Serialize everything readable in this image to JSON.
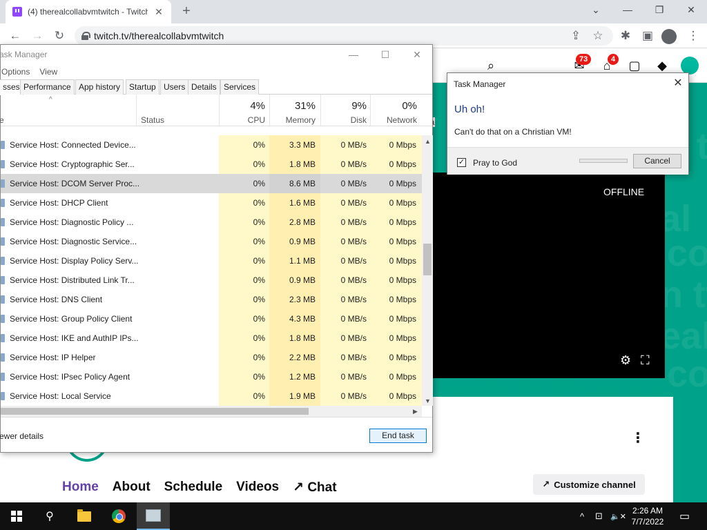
{
  "browser": {
    "tab_title": "(4) therealcollabvmtwitch - Twitch",
    "tab_close": "✕",
    "new_tab": "+",
    "url": "twitch.tv/therealcollabvmtwitch",
    "window_controls": [
      "⌄",
      "—",
      "❐",
      "✕"
    ],
    "nav": {
      "back": "←",
      "forward": "→",
      "reload": "↻"
    },
    "toolbar_icons": {
      "share": "⇪",
      "star": "☆",
      "extensions": "✱",
      "sidepanel": "▣",
      "menu": "⋮"
    }
  },
  "twitch": {
    "notifications_badge": "73",
    "inbox_badge": "4",
    "player_status": "OFFLINE",
    "background_text": [
      "itch thereal",
      "co",
      "n t",
      "eal",
      "co",
      "n tw",
      "eal",
      "co",
      "twitch thereal",
      "co",
      "n t",
      "eal"
    ],
    "channel_nav": [
      "Home",
      "About",
      "Schedule",
      "Videos",
      "Chat"
    ],
    "chat_arrow": "↗",
    "customize_label": "Customize channel",
    "customize_arrow": "↗",
    "kebab": "⋮",
    "icons": {
      "search": "⌕",
      "bell": "✉",
      "inbox": "⌂",
      "chat": "▢",
      "prime": "◆"
    },
    "player_icons": {
      "settings": "⚙",
      "fullscreen": "⛶"
    },
    "partial_text": "ial"
  },
  "task_manager": {
    "title": "Task Manager",
    "title_partial": "ask Manager",
    "window_controls": [
      "—",
      "☐",
      "✕"
    ],
    "menu": [
      "Options",
      "View"
    ],
    "tabs": [
      "sses",
      "Performance",
      "App history",
      "Startup",
      "Users",
      "Details",
      "Services"
    ],
    "header": {
      "name": "e",
      "status": "Status",
      "cpu_pct": "4%",
      "cpu": "CPU",
      "mem_pct": "31%",
      "mem": "Memory",
      "disk_pct": "9%",
      "disk": "Disk",
      "net_pct": "0%",
      "net": "Network",
      "sort_caret": "^"
    },
    "rows": [
      {
        "name": "Service Host: Connected Device...",
        "cpu": "0%",
        "memory": "3.3 MB",
        "disk": "0 MB/s",
        "network": "0 Mbps"
      },
      {
        "name": "Service Host: Cryptographic Ser...",
        "cpu": "0%",
        "memory": "1.8 MB",
        "disk": "0 MB/s",
        "network": "0 Mbps"
      },
      {
        "name": "Service Host: DCOM Server Proc...",
        "cpu": "0%",
        "memory": "8.6 MB",
        "disk": "0 MB/s",
        "network": "0 Mbps"
      },
      {
        "name": "Service Host: DHCP Client",
        "cpu": "0%",
        "memory": "1.6 MB",
        "disk": "0 MB/s",
        "network": "0 Mbps"
      },
      {
        "name": "Service Host: Diagnostic Policy ...",
        "cpu": "0%",
        "memory": "2.8 MB",
        "disk": "0 MB/s",
        "network": "0 Mbps"
      },
      {
        "name": "Service Host: Diagnostic Service...",
        "cpu": "0%",
        "memory": "0.9 MB",
        "disk": "0 MB/s",
        "network": "0 Mbps"
      },
      {
        "name": "Service Host: Display Policy Serv...",
        "cpu": "0%",
        "memory": "1.1 MB",
        "disk": "0 MB/s",
        "network": "0 Mbps"
      },
      {
        "name": "Service Host: Distributed Link Tr...",
        "cpu": "0%",
        "memory": "0.9 MB",
        "disk": "0 MB/s",
        "network": "0 Mbps"
      },
      {
        "name": "Service Host: DNS Client",
        "cpu": "0%",
        "memory": "2.3 MB",
        "disk": "0 MB/s",
        "network": "0 Mbps"
      },
      {
        "name": "Service Host: Group Policy Client",
        "cpu": "0%",
        "memory": "4.3 MB",
        "disk": "0 MB/s",
        "network": "0 Mbps"
      },
      {
        "name": "Service Host: IKE and AuthIP IPs...",
        "cpu": "0%",
        "memory": "1.8 MB",
        "disk": "0 MB/s",
        "network": "0 Mbps"
      },
      {
        "name": "Service Host: IP Helper",
        "cpu": "0%",
        "memory": "2.2 MB",
        "disk": "0 MB/s",
        "network": "0 Mbps"
      },
      {
        "name": "Service Host: IPsec Policy Agent",
        "cpu": "0%",
        "memory": "1.2 MB",
        "disk": "0 MB/s",
        "network": "0 Mbps"
      },
      {
        "name": "Service Host: Local Service",
        "cpu": "0%",
        "memory": "1.9 MB",
        "disk": "0 MB/s",
        "network": "0 Mbps"
      }
    ],
    "selected_row": 2,
    "fewer_details": "ewer details",
    "end_task": "End task",
    "scroll_arrows": {
      "up": "▲",
      "down": "▼",
      "right": "▶"
    }
  },
  "dialog": {
    "title": "Task Manager",
    "close": "✕",
    "heading": "Uh oh!",
    "message": "Can't do that on a Christian VM!",
    "checkbox_checked": true,
    "checkbox_mark": "✓",
    "checkbox_label": "Pray to God",
    "cancel_label": "Cancel"
  },
  "taskbar": {
    "time": "2:26 AM",
    "date": "7/7/2022",
    "tray": {
      "chevron": "^",
      "network": "⊡",
      "volume": "🔈✕",
      "notifications": "▭"
    },
    "search_icon": "⚲"
  },
  "colors": {
    "twitch_purple": "#9146ff",
    "teal": "#00a389",
    "badge_red": "#e91916",
    "dialog_heading": "#1e3c88",
    "endtask_border": "#0078d7"
  }
}
